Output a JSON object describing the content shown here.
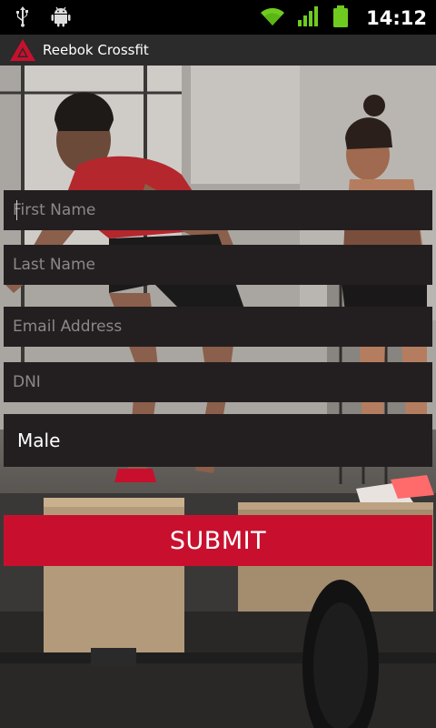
{
  "status_bar": {
    "time": "14:12",
    "icons": [
      "usb-icon",
      "android-debug-icon",
      "wifi-icon",
      "signal-icon",
      "battery-icon"
    ]
  },
  "app_bar": {
    "title": "Reebok Crossfit",
    "logo_icon": "reebok-delta-logo-icon"
  },
  "form": {
    "first_name_placeholder": "First Name",
    "last_name_placeholder": "Last Name",
    "email_placeholder": "Email Address",
    "dni_placeholder": "DNI",
    "gender_value": "Male",
    "submit_label": "SUBMIT"
  },
  "colors": {
    "accent": "#c8102e",
    "field_bg": "#231f20",
    "appbar_bg": "#2b2b2b"
  }
}
